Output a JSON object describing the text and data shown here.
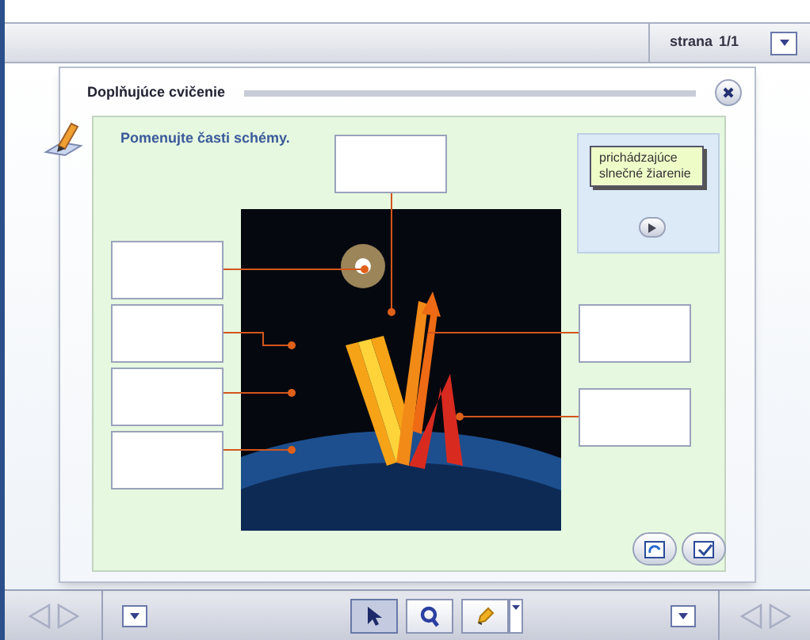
{
  "top_bar": {
    "page_label": "strana",
    "page_number": "1/1"
  },
  "dialog": {
    "title": "Doplňujúce cvičenie",
    "instruction": "Pomenujte časti schémy.",
    "hint_card": {
      "text": "prichádzajúce slnečné žiarenie"
    },
    "answer_fields": [
      {
        "kind": "top"
      },
      {
        "kind": "left"
      },
      {
        "kind": "left"
      },
      {
        "kind": "left"
      },
      {
        "kind": "left"
      },
      {
        "kind": "right"
      },
      {
        "kind": "right"
      }
    ]
  },
  "toolbar": {
    "tools": [
      {
        "kind": "pointer",
        "selected": true
      },
      {
        "kind": "zoom",
        "selected": false
      },
      {
        "kind": "marker",
        "selected": false
      }
    ]
  }
}
